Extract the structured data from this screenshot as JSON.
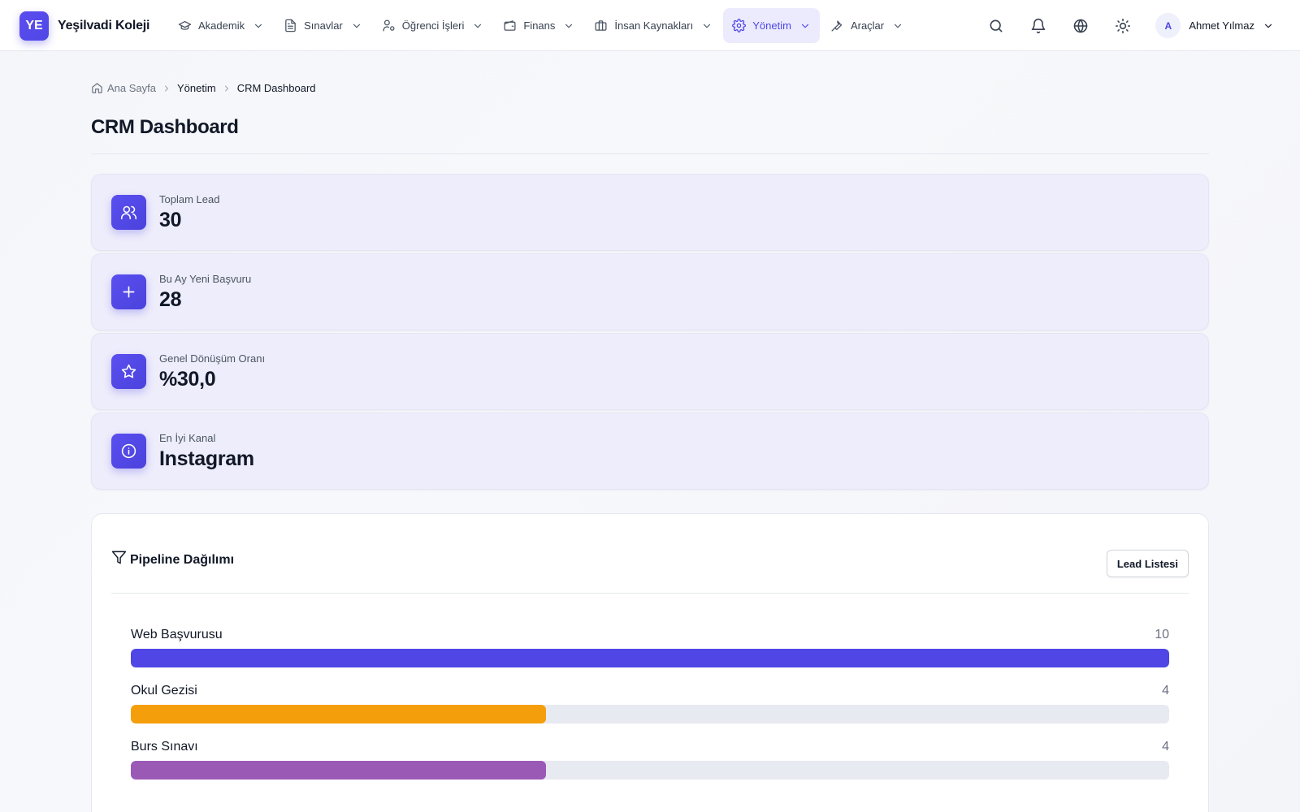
{
  "brand": {
    "logo_text": "YE",
    "name": "Yeşilvadi Koleji"
  },
  "nav": {
    "items": [
      {
        "label": "Akademik",
        "icon": "graduation-cap-icon",
        "active": false
      },
      {
        "label": "Sınavlar",
        "icon": "document-icon",
        "active": false
      },
      {
        "label": "Öğrenci İşleri",
        "icon": "user-gear-icon",
        "active": false
      },
      {
        "label": "Finans",
        "icon": "wallet-icon",
        "active": false
      },
      {
        "label": "İnsan Kaynakları",
        "icon": "briefcase-icon",
        "active": false
      },
      {
        "label": "Yönetim",
        "icon": "gear-icon",
        "active": true
      },
      {
        "label": "Araçlar",
        "icon": "wrench-icon",
        "active": false
      }
    ],
    "right_icons": [
      "search-icon",
      "bell-icon",
      "globe-icon",
      "sun-icon"
    ],
    "user": {
      "initial": "A",
      "name": "Ahmet Yılmaz"
    }
  },
  "breadcrumb": {
    "home": "Ana Sayfa",
    "section": "Yönetim",
    "current": "CRM Dashboard"
  },
  "page_title": "CRM Dashboard",
  "stats": [
    {
      "label": "Toplam Lead",
      "value": "30",
      "icon": "users-icon"
    },
    {
      "label": "Bu Ay Yeni Başvuru",
      "value": "28",
      "icon": "plus-icon"
    },
    {
      "label": "Genel Dönüşüm Oranı",
      "value": "%30,0",
      "icon": "star-icon"
    },
    {
      "label": "En İyi Kanal",
      "value": "Instagram",
      "icon": "info-icon"
    }
  ],
  "pipeline": {
    "title": "Pipeline Dağılımı",
    "button": "Lead Listesi",
    "max": 10,
    "rows": [
      {
        "name": "Web Başvurusu",
        "count": 10,
        "color": "#4f46e5"
      },
      {
        "name": "Okul Gezisi",
        "count": 4,
        "color": "#f59e0b"
      },
      {
        "name": "Burs Sınavı",
        "count": 4,
        "color": "#9b59b6"
      }
    ]
  },
  "colors": {
    "accent": "#4f46e5",
    "active_bg": "#ecebfd",
    "card_bg": "#eeedfb"
  }
}
